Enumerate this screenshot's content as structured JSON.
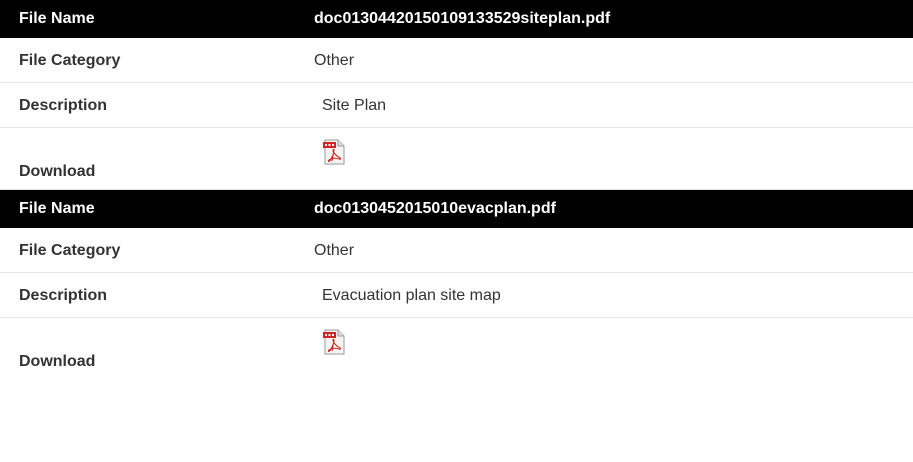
{
  "labels": {
    "file_name": "File Name",
    "file_category": "File Category",
    "description": "Description",
    "download": "Download"
  },
  "files": [
    {
      "file_name": "doc01304420150109133529siteplan.pdf",
      "file_category": "Other",
      "description": "Site Plan",
      "download_icon": "pdf-icon"
    },
    {
      "file_name": "doc0130452015010evacplan.pdf",
      "file_category": "Other",
      "description": "Evacuation plan site map",
      "download_icon": "pdf-icon"
    }
  ],
  "colors": {
    "header_background": "#000000",
    "header_text": "#ffffff",
    "row_text": "#333333",
    "row_divider": "#e6e6e6",
    "pdf_red": "#d2231e"
  }
}
